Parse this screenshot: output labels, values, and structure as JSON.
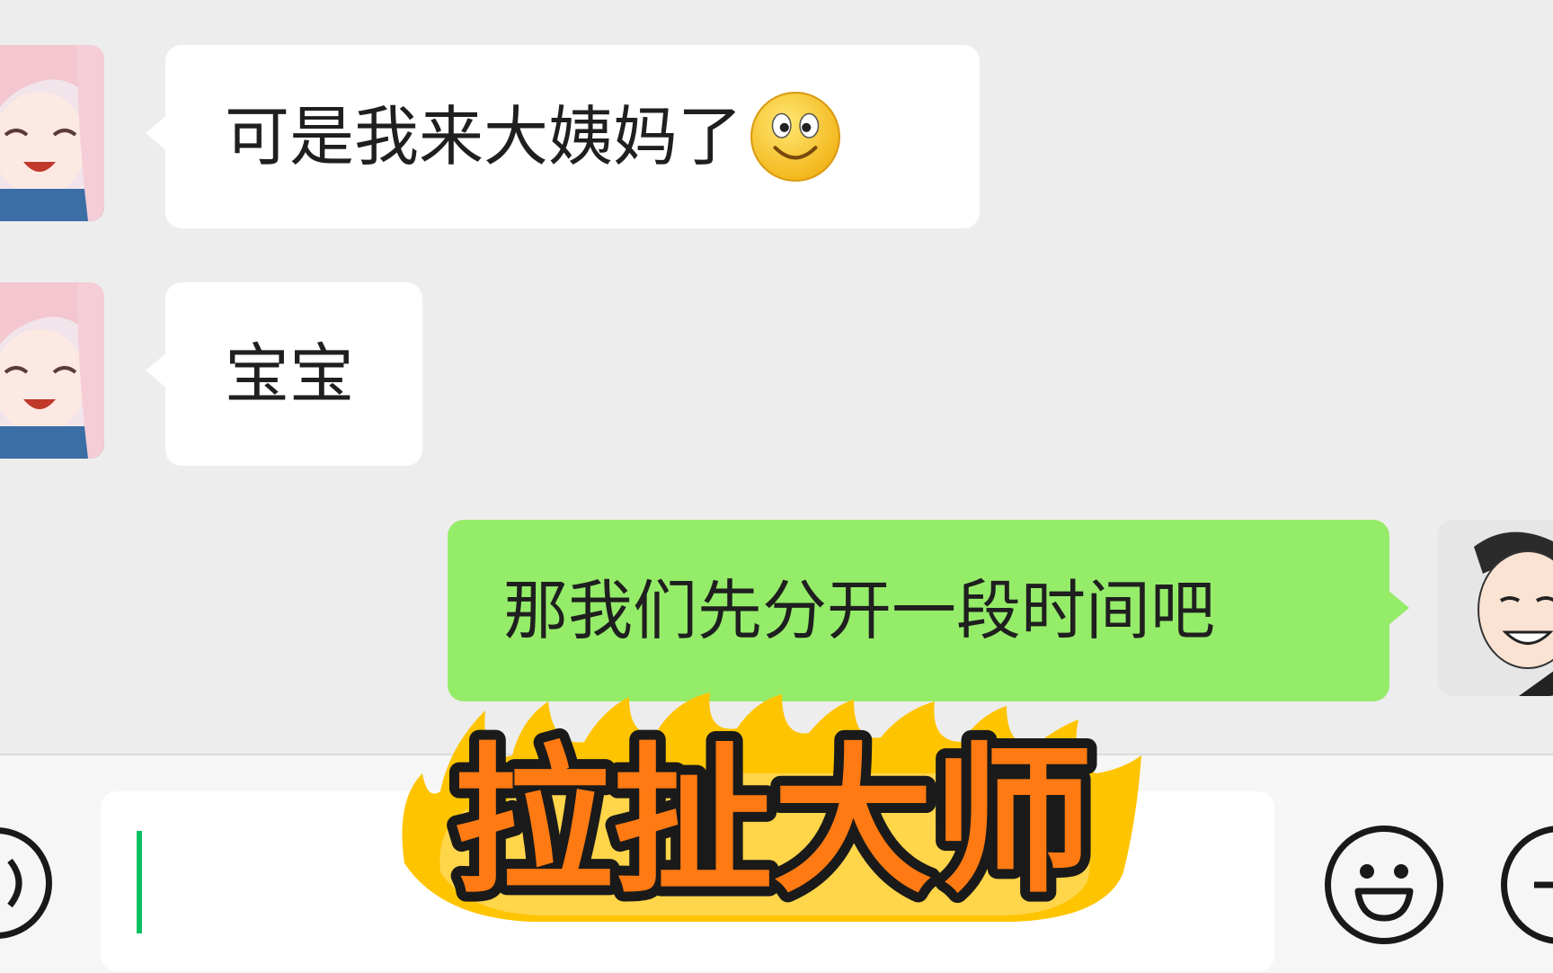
{
  "messages": [
    {
      "side": "in",
      "text": "可是我来大姨妈了",
      "emoji": "smile-emoji"
    },
    {
      "side": "in",
      "text": "宝宝"
    },
    {
      "side": "out",
      "text": "那我们先分开一段时间吧"
    }
  ],
  "overlay": {
    "text": "拉扯大师"
  },
  "colors": {
    "background": "#ededed",
    "incoming_bubble": "#ffffff",
    "outgoing_bubble": "#95ec69",
    "caret": "#07c160",
    "overlay_fill": "#ff7a12",
    "flame": "#ffc400"
  },
  "icons": {
    "left_button": "voice-icon",
    "emoji_button": "emoji-face-icon",
    "right_button": "add-more-icon"
  }
}
